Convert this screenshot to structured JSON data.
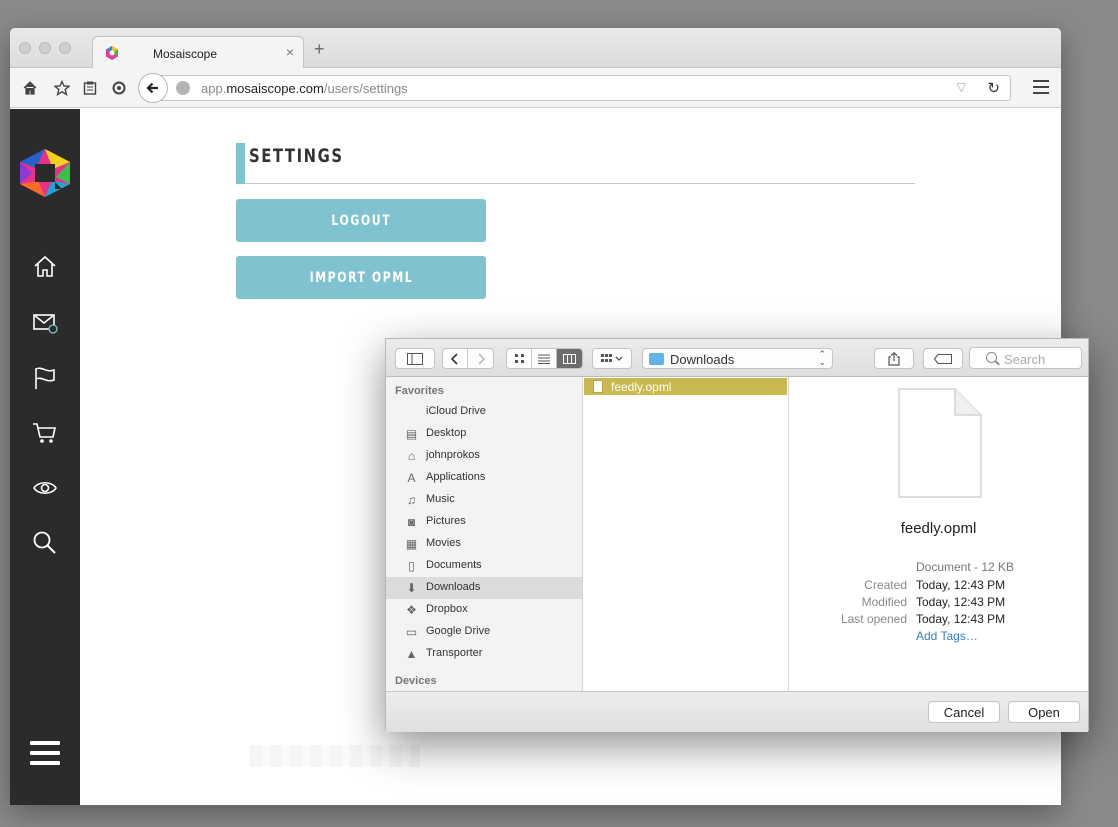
{
  "browser": {
    "tab_title": "Mosaiscope",
    "tab_close": "×",
    "new_tab": "+",
    "url_host_prefix": "app.",
    "url_host": "mosaiscope.com",
    "url_path": "/users/settings"
  },
  "page": {
    "title": "SETTINGS",
    "logout_label": "LOGOUT",
    "import_label": "IMPORT OPML",
    "accent_color": "#7fc2d0"
  },
  "sidebar_icons": [
    "home-icon",
    "mail-icon",
    "flag-icon",
    "cart-icon",
    "eye-icon",
    "search-icon"
  ],
  "dialog": {
    "location": "Downloads",
    "search_placeholder": "Search",
    "sidebar": {
      "favorites_header": "Favorites",
      "devices_header": "Devices",
      "items": [
        {
          "label": "iCloud Drive",
          "icon": ""
        },
        {
          "label": "Desktop",
          "icon": "▤"
        },
        {
          "label": "johnprokos",
          "icon": "⌂"
        },
        {
          "label": "Applications",
          "icon": "A"
        },
        {
          "label": "Music",
          "icon": "♫"
        },
        {
          "label": "Pictures",
          "icon": "◙"
        },
        {
          "label": "Movies",
          "icon": "▦"
        },
        {
          "label": "Documents",
          "icon": "▯"
        },
        {
          "label": "Downloads",
          "icon": "⬇"
        },
        {
          "label": "Dropbox",
          "icon": "❖"
        },
        {
          "label": "Google Drive",
          "icon": "▭"
        },
        {
          "label": "Transporter",
          "icon": "▲"
        }
      ],
      "selected": "Downloads"
    },
    "selected_file": "feedly.opml",
    "preview": {
      "name": "feedly.opml",
      "type": "Document - 12 KB",
      "created_label": "Created",
      "created": "Today, 12:43 PM",
      "modified_label": "Modified",
      "modified": "Today, 12:43 PM",
      "opened_label": "Last opened",
      "opened": "Today, 12:43 PM",
      "add_tags": "Add Tags…"
    },
    "cancel_label": "Cancel",
    "open_label": "Open"
  }
}
